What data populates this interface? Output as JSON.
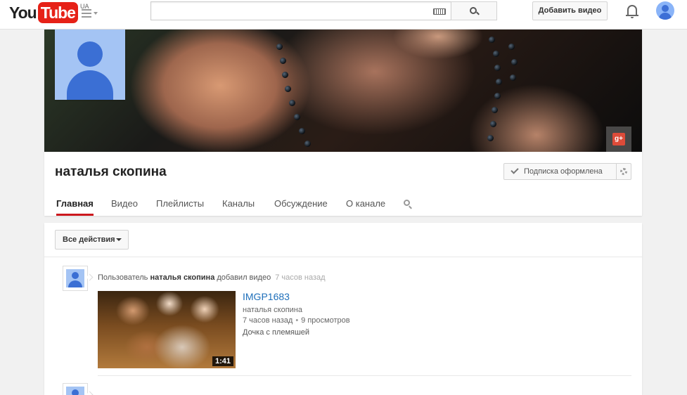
{
  "masthead": {
    "logo_you": "You",
    "logo_tube": "Tube",
    "region": "UA",
    "search_placeholder": "",
    "upload_label": "Добавить видео"
  },
  "channel": {
    "name": "наталья скопина",
    "subscribe_label": "Подписка оформлена",
    "gplus_label": "g+",
    "tabs": [
      {
        "label": "Главная",
        "active": true
      },
      {
        "label": "Видео"
      },
      {
        "label": "Плейлисты"
      },
      {
        "label": "Каналы"
      },
      {
        "label": "Обсуждение"
      },
      {
        "label": "О канале"
      }
    ]
  },
  "feed": {
    "actions_label": "Все действия",
    "items": [
      {
        "prefix": "Пользователь",
        "author": "наталья скопина",
        "action": "добавил видео",
        "time": "7 часов назад",
        "video": {
          "title": "IMGP1683",
          "channel": "наталья скопина",
          "age": "7 часов назад",
          "views": "9 просмотров",
          "description": "Дочка с племяшей",
          "duration": "1:41"
        }
      }
    ]
  },
  "colors": {
    "brand_red": "#e62117",
    "link_blue": "#1e6fba",
    "active_tab": "#cc181e"
  }
}
